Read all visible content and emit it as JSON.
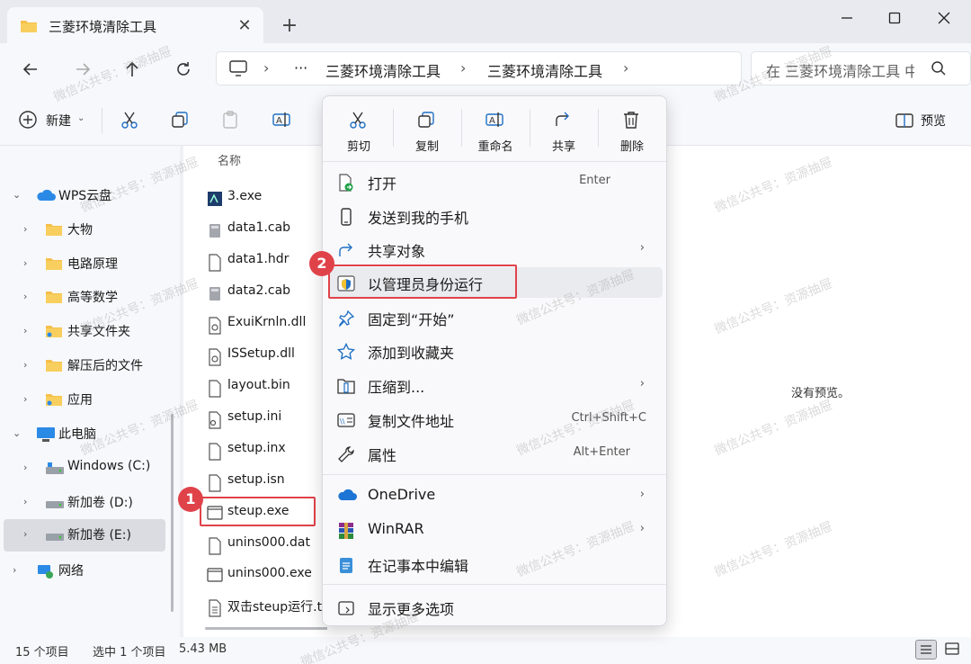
{
  "window": {
    "tab_title": "三菱环境清除工具",
    "tab_close": "✕",
    "new_tab": "+"
  },
  "address": {
    "ellipsis": "···",
    "crumbs": [
      "三菱环境清除工具",
      "三菱环境清除工具"
    ],
    "search_placeholder": "在 三菱环境清除工具 中搜索"
  },
  "toolbar": {
    "new_label": "新建",
    "preview_label": "预览"
  },
  "sidebar": {
    "items": [
      {
        "label": "WPS云盘",
        "icon": "cloud-icon",
        "expanded": true
      },
      {
        "label": "大物",
        "icon": "folder-icon"
      },
      {
        "label": "电路原理",
        "icon": "folder-icon"
      },
      {
        "label": "高等数学",
        "icon": "folder-icon"
      },
      {
        "label": "共享文件夹",
        "icon": "folder-icon"
      },
      {
        "label": "解压后的文件",
        "icon": "folder-icon"
      },
      {
        "label": "应用",
        "icon": "folder-icon"
      },
      {
        "label": "此电脑",
        "icon": "pc-icon",
        "expanded": true
      },
      {
        "label": "Windows (C:)",
        "icon": "drive-icon"
      },
      {
        "label": "新加卷 (D:)",
        "icon": "drive-icon"
      },
      {
        "label": "新加卷 (E:)",
        "icon": "drive-icon",
        "selected": true
      },
      {
        "label": "网络",
        "icon": "network-icon"
      }
    ]
  },
  "files": {
    "column_name": "名称",
    "items": [
      {
        "name": "3.exe",
        "icon": "exe-icon"
      },
      {
        "name": "data1.cab",
        "icon": "cab-icon"
      },
      {
        "name": "data1.hdr",
        "icon": "file-icon"
      },
      {
        "name": "data2.cab",
        "icon": "cab-icon"
      },
      {
        "name": "ExuiKrnln.dll",
        "icon": "dll-icon"
      },
      {
        "name": "ISSetup.dll",
        "icon": "dll-icon"
      },
      {
        "name": "layout.bin",
        "icon": "file-icon"
      },
      {
        "name": "setup.ini",
        "icon": "ini-icon"
      },
      {
        "name": "setup.inx",
        "icon": "file-icon"
      },
      {
        "name": "setup.isn",
        "icon": "file-icon"
      },
      {
        "name": "steup.exe",
        "icon": "app-icon",
        "highlighted": true
      },
      {
        "name": "unins000.dat",
        "icon": "file-icon"
      },
      {
        "name": "unins000.exe",
        "icon": "app-icon"
      },
      {
        "name": "双击steup运行.t",
        "icon": "txt-icon"
      }
    ]
  },
  "annotations": {
    "badge1": "1",
    "badge2": "2"
  },
  "context_menu": {
    "quick_actions": [
      {
        "label": "剪切",
        "icon": "scissors-icon"
      },
      {
        "label": "复制",
        "icon": "copy-icon"
      },
      {
        "label": "重命名",
        "icon": "rename-icon"
      },
      {
        "label": "共享",
        "icon": "share-icon"
      },
      {
        "label": "删除",
        "icon": "trash-icon"
      }
    ],
    "items": [
      {
        "label": "打开",
        "shortcut": "Enter",
        "icon": "open-icon"
      },
      {
        "label": "发送到我的手机",
        "icon": "phone-icon"
      },
      {
        "label": "共享对象",
        "icon": "share-icon",
        "submenu": true
      },
      {
        "label": "以管理员身份运行",
        "icon": "shield-icon",
        "highlighted": true
      },
      {
        "label": "固定到“开始”",
        "icon": "pin-icon"
      },
      {
        "label": "添加到收藏夹",
        "icon": "star-icon"
      },
      {
        "label": "压缩到...",
        "icon": "zip-icon",
        "submenu": true
      },
      {
        "label": "复制文件地址",
        "shortcut": "Ctrl+Shift+C",
        "icon": "copy-path-icon"
      },
      {
        "label": "属性",
        "shortcut": "Alt+Enter",
        "icon": "wrench-icon"
      },
      {
        "label": "OneDrive",
        "icon": "onedrive-icon",
        "submenu": true
      },
      {
        "label": "WinRAR",
        "icon": "winrar-icon",
        "submenu": true
      },
      {
        "label": "在记事本中编辑",
        "icon": "notepad-icon"
      },
      {
        "label": "显示更多选项",
        "icon": "more-options-icon"
      }
    ]
  },
  "preview": {
    "empty_text": "没有预览。"
  },
  "status": {
    "count": "15 个项目",
    "selection": "选中 1 个项目",
    "size": "5.43 MB"
  },
  "watermark": "微信公共号：资源抽屉",
  "colors": {
    "accent": "#0067c0",
    "highlight_red": "#e0424a",
    "folder_yellow": "#f5c04a"
  }
}
